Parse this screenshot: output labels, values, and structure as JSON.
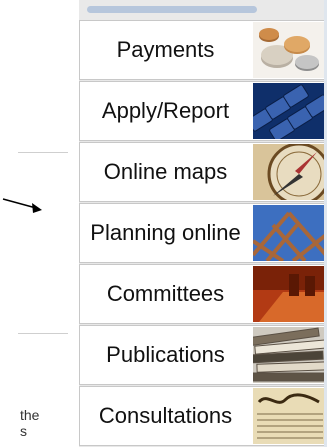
{
  "side_text": [
    "the",
    "s"
  ],
  "menu": {
    "items": [
      {
        "label": "Payments",
        "icon": "coins-icon"
      },
      {
        "label": "Apply/Report",
        "icon": "keyboard-icon"
      },
      {
        "label": "Online maps",
        "icon": "compass-icon"
      },
      {
        "label": "Planning online",
        "icon": "roof-frame-icon"
      },
      {
        "label": "Committees",
        "icon": "meeting-table-icon"
      },
      {
        "label": "Publications",
        "icon": "books-icon"
      },
      {
        "label": "Consultations",
        "icon": "constitution-document-icon"
      }
    ]
  }
}
